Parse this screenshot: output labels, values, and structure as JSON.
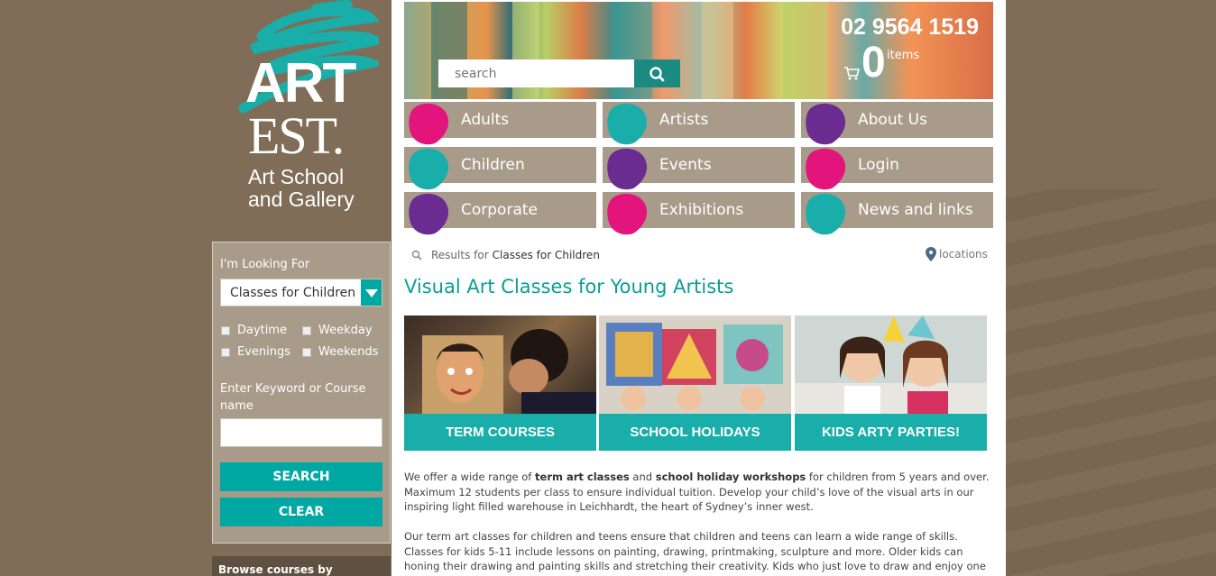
{
  "logo": {
    "art": "ART",
    "est": "EST.",
    "line1": "Art School",
    "line2": "and Gallery"
  },
  "header": {
    "search_placeholder": "search",
    "phone": "02 9564 1519",
    "cart_count": "0",
    "cart_label": "items"
  },
  "nav": [
    {
      "label": "Adults",
      "color": "#e3157d"
    },
    {
      "label": "Artists",
      "color": "#19aea9"
    },
    {
      "label": "About Us",
      "color": "#6a2c91"
    },
    {
      "label": "Children",
      "color": "#19aea9"
    },
    {
      "label": "Events",
      "color": "#6a2c91"
    },
    {
      "label": "Login",
      "color": "#e3157d"
    },
    {
      "label": "Corporate",
      "color": "#6a2c91"
    },
    {
      "label": "Exhibitions",
      "color": "#e3157d"
    },
    {
      "label": "News and links",
      "color": "#19aea9"
    }
  ],
  "sidebar": {
    "looking_for_label": "I'm Looking For",
    "selected": "Classes for Children",
    "checkboxes": [
      "Daytime",
      "Weekday",
      "Evenings",
      "Weekends"
    ],
    "keyword_label": "Enter Keyword or Course name",
    "search_button": "SEARCH",
    "clear_button": "CLEAR",
    "demographic": "Browse courses by Demographic"
  },
  "results": {
    "prefix": "Results for",
    "query": "Classes for Children",
    "locations": "locations"
  },
  "page_title": "Visual Art Classes for Young Artists",
  "cards": [
    {
      "caption": "TERM COURSES"
    },
    {
      "caption": "SCHOOL HOLIDAYS"
    },
    {
      "caption": "KIDS ARTY PARTIES!"
    }
  ],
  "para1": {
    "a": "We offer a wide range of ",
    "b1": "term art classes",
    "c": " and ",
    "b2": "school holiday workshops",
    "d": " for children from 5 years and over. Maximum 12 students per class to ensure individual tuition. Develop your child’s love of the visual arts in our inspiring light filled warehouse in Leichhardt, the heart of Sydney’s inner west."
  },
  "para2": "Our term art classes for children and teens ensure that children and teens can learn a wide range of skills. Classes for kids 5-11 include lessons on painting, drawing, printmaking, sculpture and more. Older kids can honing their drawing and painting skills and stretching their creativity. Kids who just love to draw and enjoy one of our Just Draw",
  "colors": {
    "teal": "#19aea9",
    "brown": "#7f6d57",
    "taupe": "#a99b8a",
    "magenta": "#e3157d",
    "purple": "#6a2c91"
  }
}
